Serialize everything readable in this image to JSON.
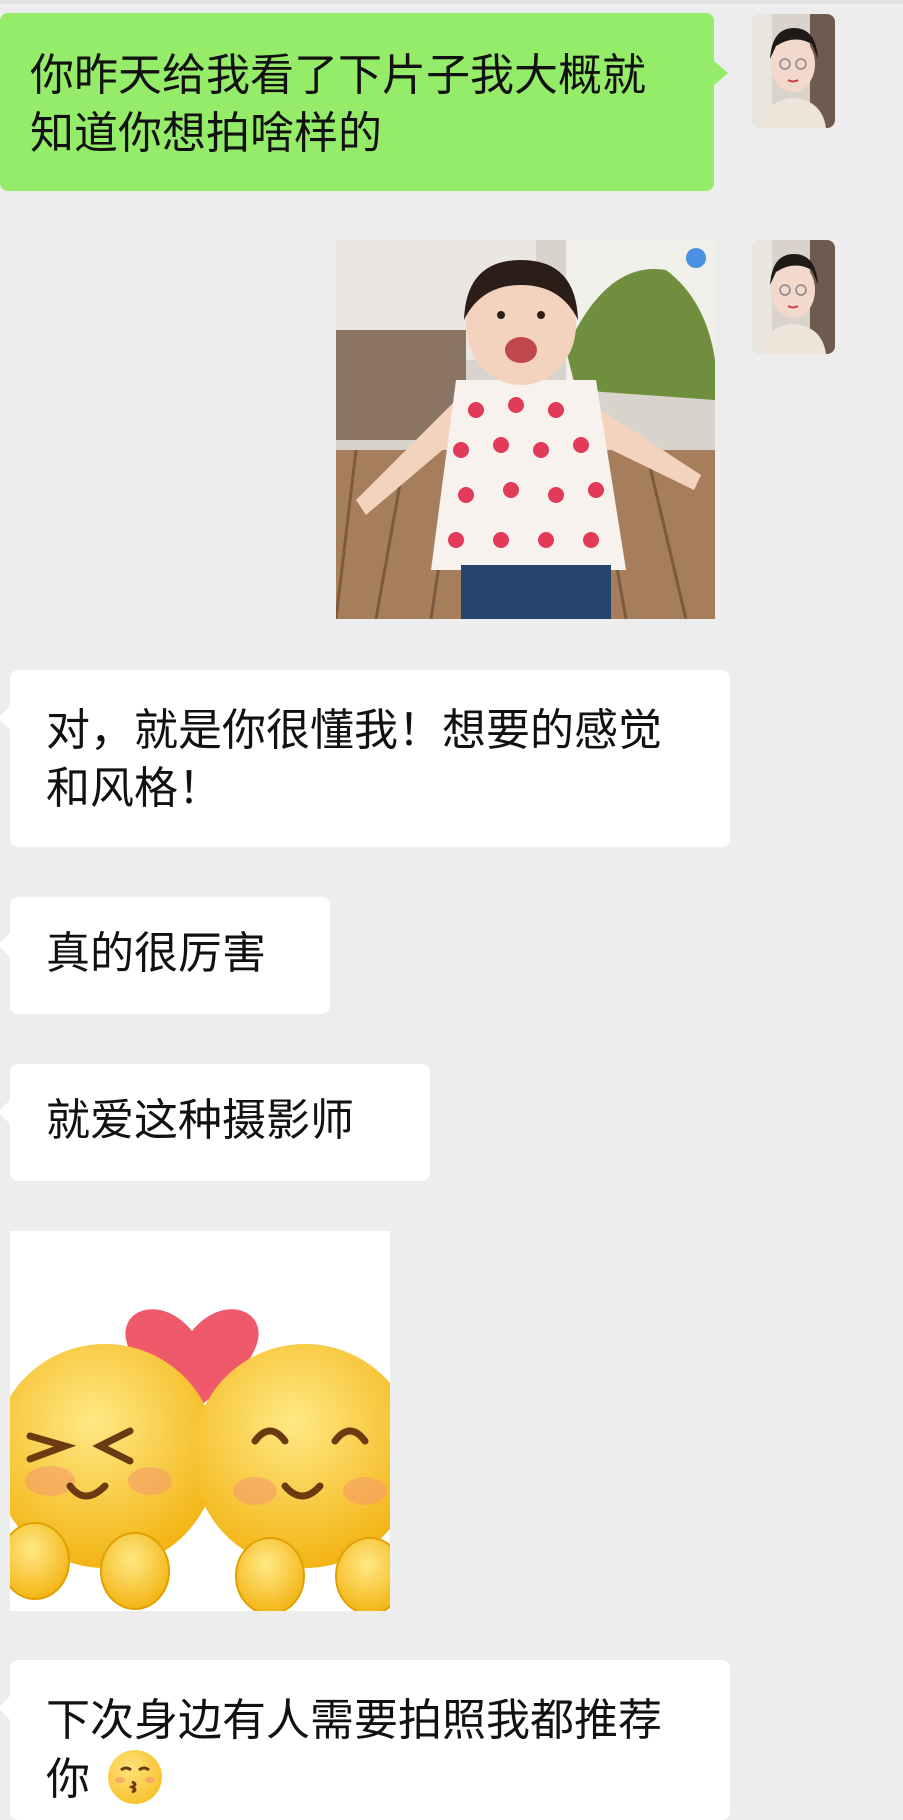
{
  "messages": [
    {
      "side": "self",
      "type": "text",
      "text": "你昨天给我看了下片子我大概就知道你想拍啥样的"
    },
    {
      "side": "self",
      "type": "image",
      "image": "toddler-in-polka-dot-dress-photo"
    },
    {
      "side": "other",
      "type": "text",
      "text": "对，就是你很懂我！想要的感觉和风格！"
    },
    {
      "side": "other",
      "type": "text",
      "text": "真的很厉害"
    },
    {
      "side": "other",
      "type": "text",
      "text": "就爱这种摄影师"
    },
    {
      "side": "other",
      "type": "sticker",
      "image": "two-smiling-emoji-faces-with-heart-sticker"
    },
    {
      "side": "other",
      "type": "text",
      "text": "下次身边有人需要拍照我都推荐你",
      "trailing_emoji": "blowing-kiss-emoji"
    }
  ],
  "colors": {
    "background": "#ededed",
    "self_bubble": "#95ec69",
    "other_bubble": "#ffffff"
  }
}
